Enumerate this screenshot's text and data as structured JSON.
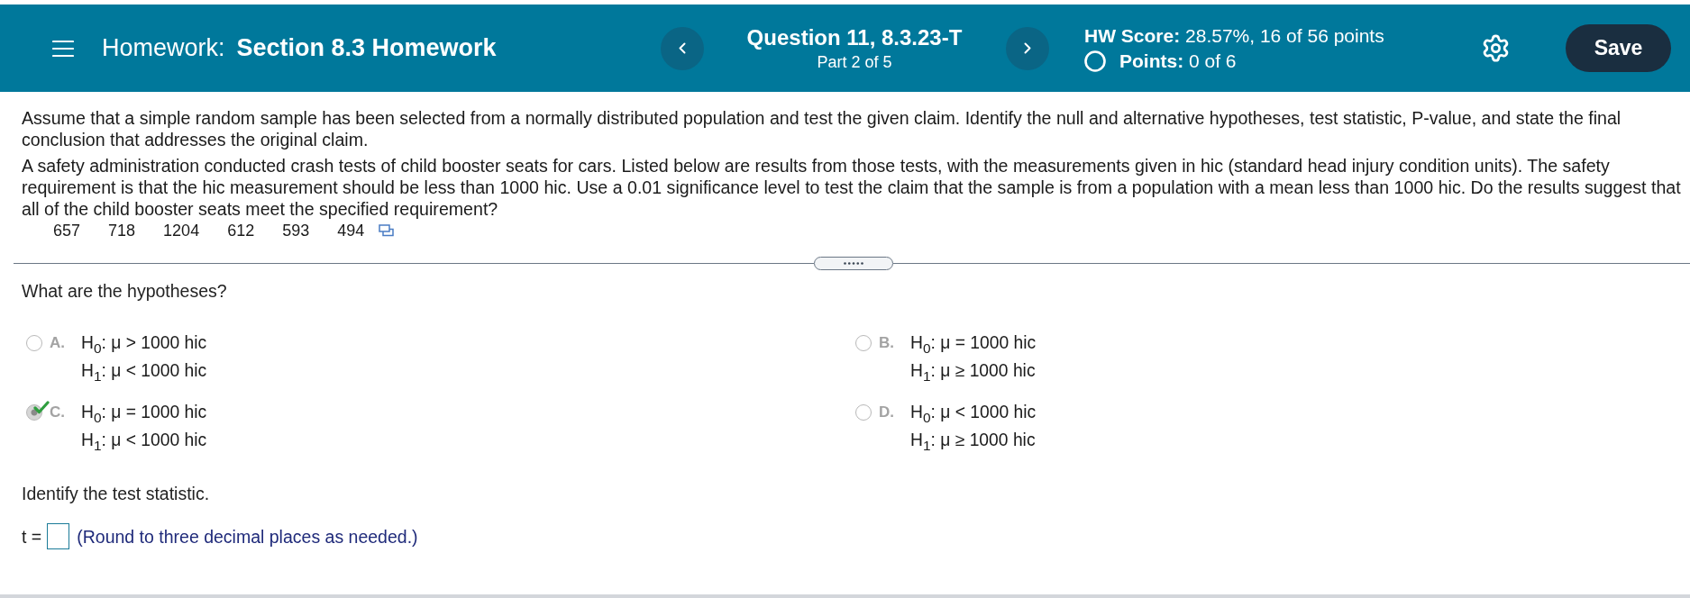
{
  "header": {
    "title_label": "Homework:",
    "title": "Section 8.3 Homework",
    "question": {
      "title": "Question 11, 8.3.23-T",
      "part": "Part 2 of 5"
    },
    "score": "**HW Score:** 28.57%, 16 of 56 points",
    "points": "**Points:** 0 of 6",
    "save_button": "Save"
  },
  "instructions": "Assume that a simple random sample has been selected from a normally distributed population and test the given claim. Identify the null and alternative hypotheses, test statistic, P-value, and state the final conclusion that addresses the original claim.",
  "problem": "A safety administration conducted crash tests of child booster seats for cars. Listed below are results from those tests, with the measurements given in hic (standard head injury condition units). The safety requirement is that the hic measurement should be less than 1000 hic. Use a 0.01 significance level to test the claim that the sample is from a population with a mean less than 1000 hic. Do the results suggest that all of the child booster seats meet the specified requirement?",
  "data_values": [
    "657",
    "718",
    "1204",
    "612",
    "593",
    "494"
  ],
  "hypotheses": {
    "prompt": "What are the hypotheses?",
    "options": [
      {
        "letter": "A.",
        "h0": "H$_{0}$: μ > 1000 hic",
        "h1": "H$_{1}$: μ < 1000 hic",
        "selected": false
      },
      {
        "letter": "B.",
        "h0": "H$_{0}$: μ = 1000 hic",
        "h1": "H$_{1}$: μ ≥ 1000 hic",
        "selected": false
      },
      {
        "letter": "C.",
        "h0": "H$_{0}$: μ = 1000 hic",
        "h1": "H$_{1}$: μ < 1000 hic",
        "selected": true
      },
      {
        "letter": "D.",
        "h0": "H$_{0}$: μ < 1000 hic",
        "h1": "H$_{1}$: μ ≥ 1000 hic",
        "selected": false
      }
    ]
  },
  "test_statistic": {
    "prompt": "Identify the test statistic.",
    "label": "t =",
    "hint": "(Round to three decimal places as needed.)"
  }
}
